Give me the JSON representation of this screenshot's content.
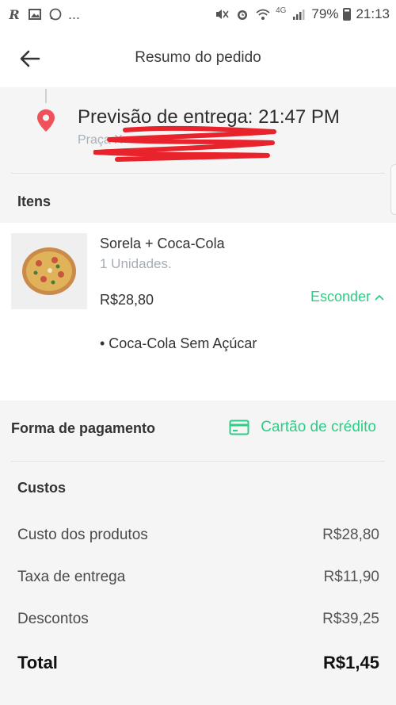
{
  "status_bar": {
    "left_icons": [
      "R",
      "image-icon",
      "whatsapp-icon",
      "..."
    ],
    "network": "4G",
    "battery": "79%",
    "time": "21:13"
  },
  "header": {
    "title": "Resumo do pedido",
    "back_icon": "arrow-left-icon"
  },
  "delivery": {
    "title": "Previsão de entrega: 21:47 PM",
    "address": "Praça X",
    "pin_color": "#f0525b"
  },
  "items_section": {
    "label": "Itens",
    "items": [
      {
        "name": "Sorela + Coca-Cola",
        "quantity": "1 Unidades.",
        "price": "R$28,80",
        "toggle_label": "Esconder",
        "addons": [
          "• Coca-Cola Sem Açúcar"
        ]
      }
    ]
  },
  "payment": {
    "label": "Forma de pagamento",
    "method": "Cartão de crédito",
    "icon": "credit-card-icon"
  },
  "costs": {
    "label": "Custos",
    "rows": [
      {
        "label": "Custo dos produtos",
        "value": "R$28,80"
      },
      {
        "label": "Taxa de entrega",
        "value": "R$11,90"
      },
      {
        "label": "Descontos",
        "value": "R$39,25"
      }
    ],
    "total_label": "Total",
    "total_value": "R$1,45"
  },
  "colors": {
    "accent": "#2ecc85",
    "pin": "#f0525b",
    "redaction": "#e8232b",
    "background": "#f5f5f5"
  }
}
